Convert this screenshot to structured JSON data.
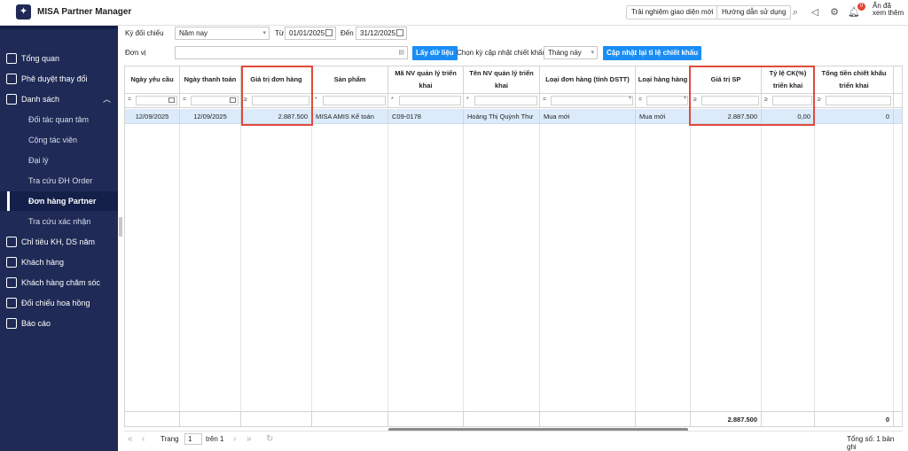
{
  "app": {
    "title": "MISA Partner Manager"
  },
  "topbar": {
    "try_new_ui": "Trải nghiệm giao diện mới",
    "user_guide": "Hướng dẫn sử dụng",
    "notification_count": "0",
    "user_name": "Ẩn đã xem thêm"
  },
  "sidebar": {
    "items": [
      {
        "label": "Tổng quan",
        "icon": "home-icon"
      },
      {
        "label": "Phê duyệt thay đổi",
        "icon": "mail-icon"
      },
      {
        "label": "Danh sách",
        "icon": "list-icon"
      }
    ],
    "sub_items": [
      {
        "label": "Đối tác quan tâm"
      },
      {
        "label": "Cộng tác viên"
      },
      {
        "label": "Đại lý"
      },
      {
        "label": "Tra cứu ĐH Order"
      },
      {
        "label": "Đơn hàng Partner",
        "active": true
      },
      {
        "label": "Tra cứu xác nhận"
      }
    ],
    "items2": [
      {
        "label": "Chỉ tiêu KH, DS năm",
        "icon": "target-icon"
      },
      {
        "label": "Khách hàng",
        "icon": "customer-icon"
      },
      {
        "label": "Khách hàng chăm sóc",
        "icon": "care-icon"
      },
      {
        "label": "Đối chiếu hoa hồng",
        "icon": "commission-icon"
      },
      {
        "label": "Báo cáo",
        "icon": "report-icon"
      }
    ]
  },
  "filters": {
    "period_label": "Kỳ đối chiếu",
    "period_value": "Năm nay",
    "from_label": "Từ",
    "from_value": "01/01/2025",
    "to_label": "Đến",
    "to_value": "31/12/2025",
    "unit_label": "Đơn vị",
    "unit_value": "",
    "load_button": "Lấy dữ liệu",
    "discount_period_label": "Chọn kỳ cập nhật chiết khấu",
    "discount_period_value": "Tháng này",
    "update_discount_button": "Cập nhật lại tỉ lệ chiết khấu"
  },
  "grid": {
    "columns": [
      "Ngày yêu cầu",
      "Ngày thanh toán",
      "Giá trị đơn hàng",
      "Sản phẩm",
      "Mã NV quản lý triển khai",
      "Tên NV quản lý triển khai",
      "Loại đơn hàng (tính DSTT)",
      "Loại hàng hàng",
      "Giá trị SP",
      "Tỷ lệ CK(%) triển khai",
      "Tổng tiền chiết khấu triển khai"
    ],
    "rows": [
      [
        "12/09/2025",
        "12/09/2025",
        "2.887.500",
        "MISA AMIS Kế toán",
        "C09-0178",
        "Hoàng Thị Quỳnh Thư",
        "Mua mới",
        "Mua mới",
        "2.887.500",
        "0,00",
        "0"
      ]
    ],
    "footer": {
      "order_value_total": "",
      "product_value_total": "2.887.500",
      "discount_total": "0"
    }
  },
  "pager": {
    "page_label": "Trang",
    "page_value": "1",
    "of_label": "trên 1",
    "total_label": "Tổng số: 1 bản ghi"
  }
}
